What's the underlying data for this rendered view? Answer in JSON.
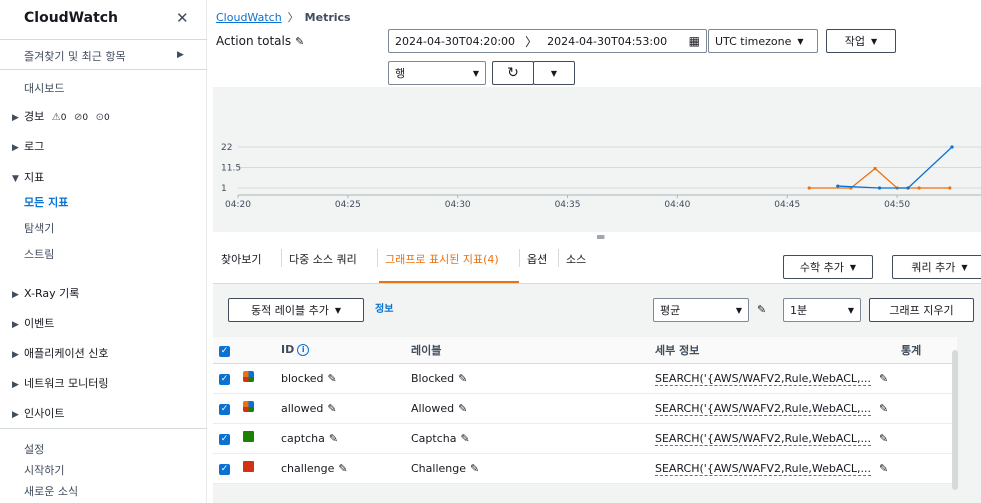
{
  "sidebar": {
    "title": "CloudWatch",
    "close_icon": "close-icon",
    "favorites": "즐겨찾기 및 최근 항목",
    "dashboard": "대시보드",
    "alarms": {
      "label": "경보",
      "in_alarm": "0",
      "ok": "0",
      "insufficient": "0"
    },
    "logs": "로그",
    "metrics": "지표",
    "all_metrics": "모든 지표",
    "explorer": "탐색기",
    "streams": "스트림",
    "xray": "X-Ray 기록",
    "events": "이벤트",
    "app_signals": "애플리케이션 신호",
    "network_monitoring": "네트워크 모니터링",
    "insights": "인사이트",
    "settings": "설정",
    "getting_started": "시작하기",
    "whats_new": "새로운 소식"
  },
  "breadcrumb": {
    "root": "CloudWatch",
    "current": "Metrics"
  },
  "page_title": "Action totals",
  "time_range": {
    "start": "2024-04-30T04:20:00",
    "end": "2024-04-30T04:53:00"
  },
  "timezone": "UTC timezone",
  "actions_label": "작업",
  "view_type": "행",
  "chart_data": {
    "type": "line",
    "x_ticks": [
      "04:20",
      "04:25",
      "04:30",
      "04:35",
      "04:40",
      "04:45",
      "04:50"
    ],
    "y_ticks": [
      "22",
      "11.5",
      "1"
    ],
    "ylim": [
      1,
      22
    ],
    "grid": true,
    "series": [
      {
        "color": "#ec7211",
        "points": [
          [
            46.0,
            1
          ],
          [
            47.9,
            1
          ],
          [
            49.0,
            11
          ],
          [
            50.0,
            1
          ],
          [
            51.0,
            1
          ],
          [
            52.4,
            1
          ]
        ]
      },
      {
        "color": "#0972d3",
        "points": [
          [
            47.3,
            2
          ],
          [
            49.2,
            1
          ],
          [
            50.5,
            1
          ],
          [
            52.5,
            22
          ]
        ]
      }
    ]
  },
  "tabs": {
    "browse": "찾아보기",
    "multi_source": "다중 소스 쿼리",
    "graphed": "그래프로 표시된 지표(4)",
    "options": "옵션",
    "source": "소스"
  },
  "buttons": {
    "add_math": "수학 추가",
    "add_query": "쿼리 추가",
    "add_dynamic_label": "동적 레이블 추가",
    "info": "정보",
    "clear_graph": "그래프 지우기"
  },
  "statistic": "평균",
  "period": "1분",
  "table": {
    "headers": {
      "id": "ID",
      "label": "레이블",
      "details": "세부 정보",
      "stats": "통계"
    },
    "rows": [
      {
        "id": "blocked",
        "label": "Blocked",
        "details": "SEARCH('{AWS/WAFV2,Rule,WebACL,..."
      },
      {
        "id": "allowed",
        "label": "Allowed",
        "details": "SEARCH('{AWS/WAFV2,Rule,WebACL,..."
      },
      {
        "id": "captcha",
        "label": "Captcha",
        "details": "SEARCH('{AWS/WAFV2,Rule,WebACL,..."
      },
      {
        "id": "challenge",
        "label": "Challenge",
        "details": "SEARCH('{AWS/WAFV2,Rule,WebACL,..."
      }
    ],
    "row_colors": [
      "multi",
      "multi",
      "#1d8102",
      "#d13212"
    ]
  }
}
